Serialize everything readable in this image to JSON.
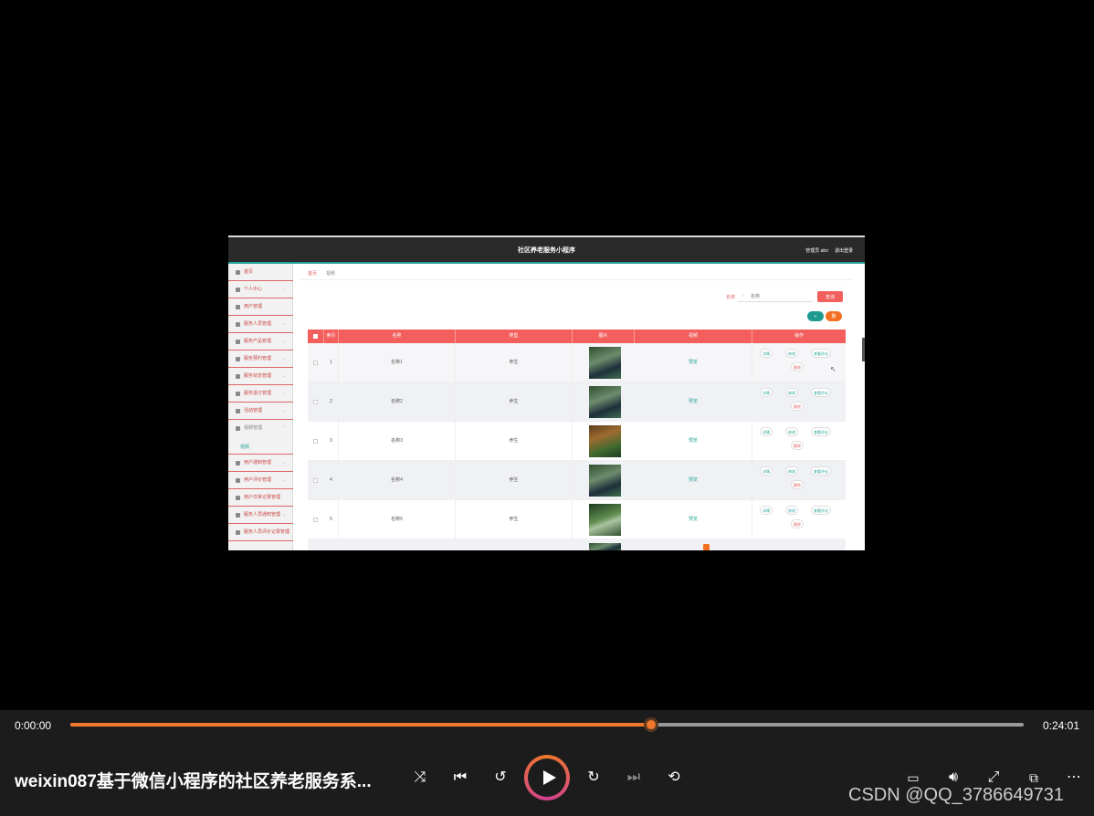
{
  "app": {
    "title": "社区养老服务小程序",
    "admin": "管理员 abo",
    "logout": "退出登录"
  },
  "sidebar": {
    "items": [
      {
        "label": "首页",
        "icon": "home-icon"
      },
      {
        "label": "个人中心",
        "icon": "user-icon"
      },
      {
        "label": "用户管理",
        "icon": "users-icon"
      },
      {
        "label": "服务人员管理",
        "icon": "staff-icon"
      },
      {
        "label": "服务产品管理",
        "icon": "product-icon"
      },
      {
        "label": "服务预约管理",
        "icon": "mail-icon"
      },
      {
        "label": "服务状态管理",
        "icon": "status-icon"
      },
      {
        "label": "服务退订管理",
        "icon": "refund-icon"
      },
      {
        "label": "活动管理",
        "icon": "activity-icon"
      },
      {
        "label": "视频管理",
        "icon": "video-icon"
      },
      {
        "label": "用户通知管理",
        "icon": "notice-icon"
      },
      {
        "label": "用户评价管理",
        "icon": "review-icon"
      },
      {
        "label": "用户日常记录管理",
        "icon": "record-icon"
      },
      {
        "label": "服务人员通知管理",
        "icon": "staff-notice-icon"
      },
      {
        "label": "服务人员评价记录管理",
        "icon": "staff-review-icon"
      }
    ],
    "sub_item": "视频"
  },
  "breadcrumb": {
    "home": "首页",
    "current": "视频"
  },
  "search": {
    "label": "名称",
    "placeholder": "名称",
    "button": "查询"
  },
  "actions": {
    "add": "+",
    "delete": "删"
  },
  "table": {
    "headers": [
      "",
      "索引",
      "名称",
      "类型",
      "图片",
      "视频",
      "操作"
    ],
    "rows": [
      {
        "index": "1",
        "name": "名称1",
        "type": "养生",
        "video": "预览"
      },
      {
        "index": "2",
        "name": "名称2",
        "type": "养生",
        "video": "预览"
      },
      {
        "index": "3",
        "name": "名称3",
        "type": "养生",
        "video": "预览"
      },
      {
        "index": "4",
        "name": "名称4",
        "type": "养生",
        "video": "预览"
      },
      {
        "index": "5",
        "name": "名称5",
        "type": "养生",
        "video": "预览"
      }
    ],
    "ops": {
      "detail": "详情",
      "edit": "修改",
      "comment": "查看评论",
      "delete": "删除"
    }
  },
  "player": {
    "time_start": "0:00:00",
    "time_end": "0:24:01",
    "progress": 0.609,
    "title": "weixin087基于微信小程序的社区养老服务系...",
    "watermark": "CSDN @QQ_3786649731",
    "colors": {
      "accent": "#f0782a",
      "header_red": "#f25f5c",
      "teal": "#1f9a8e"
    }
  }
}
